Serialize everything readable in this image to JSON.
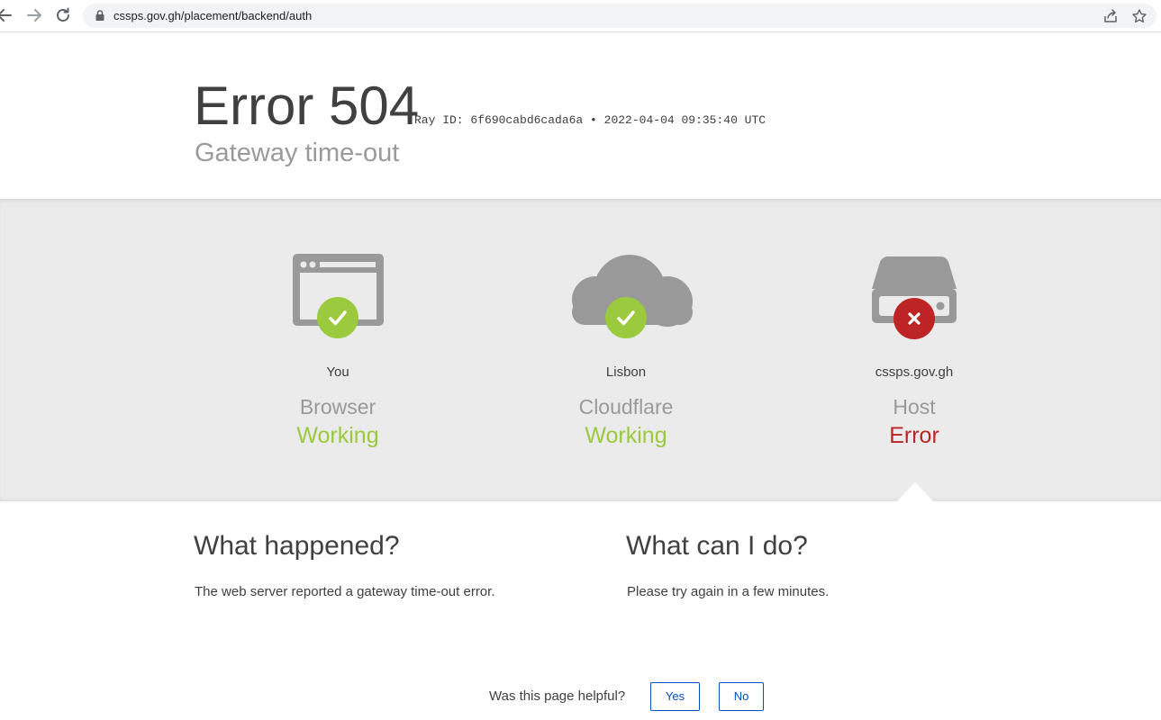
{
  "browser": {
    "url": "cssps.gov.gh/placement/backend/auth"
  },
  "header": {
    "title": "Error 504",
    "ray_label": "Ray ID: 6f690cabd6cada6a •",
    "timestamp": "2022-04-04 09:35:40 UTC",
    "subtitle": "Gateway time-out"
  },
  "nodes": [
    {
      "location": "You",
      "name": "Browser",
      "status": "Working",
      "icon": "browser-icon",
      "state": "ok"
    },
    {
      "location": "Lisbon",
      "name": "Cloudflare",
      "status": "Working",
      "icon": "cloud-icon",
      "state": "ok"
    },
    {
      "location": "cssps.gov.gh",
      "name": "Host",
      "status": "Error",
      "icon": "server-icon",
      "state": "error"
    }
  ],
  "what_happened": {
    "heading": "What happened?",
    "text": "The web server reported a gateway time-out error."
  },
  "what_can_i_do": {
    "heading": "What can I do?",
    "text": "Please try again in a few minutes."
  },
  "feedback": {
    "question": "Was this page helpful?",
    "yes_label": "Yes",
    "no_label": "No"
  },
  "colors": {
    "ok": "#9bca3e",
    "error": "#bd2426",
    "icon_gray": "#999999",
    "band": "#ebebeb",
    "link_blue": "#0051c3"
  }
}
